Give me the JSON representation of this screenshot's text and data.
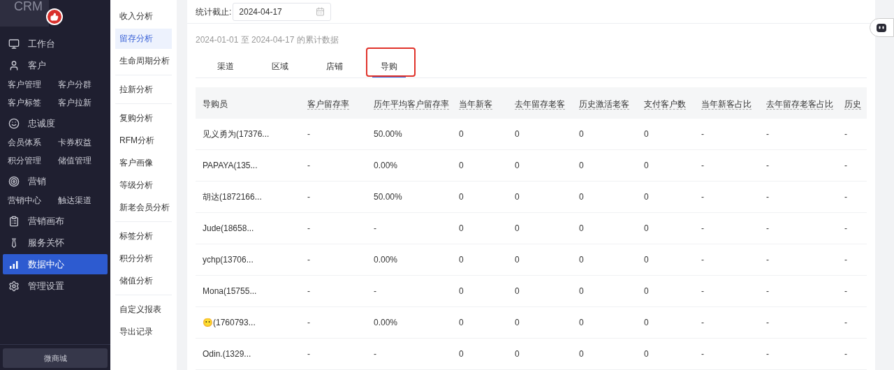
{
  "logo": {
    "text": "CRM"
  },
  "nav": [
    {
      "label": "工作台",
      "selected": false
    },
    {
      "label": "客户",
      "selected": false,
      "children": [
        "客户管理",
        "客户分群",
        "客户标签",
        "客户拉新"
      ]
    },
    {
      "label": "忠诚度",
      "selected": false,
      "children": [
        "会员体系",
        "卡券权益",
        "积分管理",
        "储值管理"
      ]
    },
    {
      "label": "营销",
      "selected": false,
      "children": [
        "营销中心",
        "触达渠道"
      ]
    },
    {
      "label": "营销画布",
      "selected": false
    },
    {
      "label": "服务关怀",
      "selected": false
    },
    {
      "label": "数据中心",
      "selected": true
    },
    {
      "label": "管理设置",
      "selected": false
    }
  ],
  "shop_button": "微商城",
  "submenu": [
    [
      {
        "label": "收入分析",
        "selected": false
      },
      {
        "label": "留存分析",
        "selected": true
      },
      {
        "label": "生命周期分析",
        "selected": false
      }
    ],
    [
      {
        "label": "拉新分析",
        "selected": false
      }
    ],
    [
      {
        "label": "复购分析",
        "selected": false
      },
      {
        "label": "RFM分析",
        "selected": false
      },
      {
        "label": "客户画像",
        "selected": false
      },
      {
        "label": "等级分析",
        "selected": false
      },
      {
        "label": "新老会员分析",
        "selected": false
      }
    ],
    [
      {
        "label": "标签分析",
        "selected": false
      },
      {
        "label": "积分分析",
        "selected": false
      },
      {
        "label": "储值分析",
        "selected": false
      }
    ],
    [
      {
        "label": "自定义报表",
        "selected": false
      },
      {
        "label": "导出记录",
        "selected": false
      }
    ]
  ],
  "filter": {
    "label": "统计截止:",
    "date": "2024-04-17"
  },
  "summary": "2024-01-01 至 2024-04-17 的累计数据",
  "tabs": [
    {
      "label": "渠道",
      "selected": false,
      "highlighted": false
    },
    {
      "label": "区域",
      "selected": false,
      "highlighted": false
    },
    {
      "label": "店铺",
      "selected": false,
      "highlighted": false
    },
    {
      "label": "导购",
      "selected": true,
      "highlighted": true
    }
  ],
  "table": {
    "columns": [
      "导购员",
      "客户留存率",
      "历年平均客户留存率",
      "当年新客",
      "去年留存老客",
      "历史激活老客",
      "支付客户数",
      "当年新客占比",
      "去年留存老客占比",
      "历史"
    ],
    "rows": [
      [
        "见义勇为(17376...",
        "-",
        "50.00%",
        "0",
        "0",
        "0",
        "0",
        "-",
        "-",
        "-"
      ],
      [
        "PAPAYA(135...",
        "-",
        "0.00%",
        "0",
        "0",
        "0",
        "0",
        "-",
        "-",
        "-"
      ],
      [
        "胡达(1872166...",
        "-",
        "50.00%",
        "0",
        "0",
        "0",
        "0",
        "-",
        "-",
        "-"
      ],
      [
        "Jude(18658...",
        "-",
        "-",
        "0",
        "0",
        "0",
        "0",
        "-",
        "-",
        "-"
      ],
      [
        "ychp(13706...",
        "-",
        "0.00%",
        "0",
        "0",
        "0",
        "0",
        "-",
        "-",
        "-"
      ],
      [
        "Mona(15755...",
        "-",
        "-",
        "0",
        "0",
        "0",
        "0",
        "-",
        "-",
        "-"
      ],
      [
        "😶(1760793...",
        "-",
        "0.00%",
        "0",
        "0",
        "0",
        "0",
        "-",
        "-",
        "-"
      ],
      [
        "Odin.(1329...",
        "-",
        "-",
        "0",
        "0",
        "0",
        "0",
        "-",
        "-",
        "-"
      ]
    ]
  }
}
